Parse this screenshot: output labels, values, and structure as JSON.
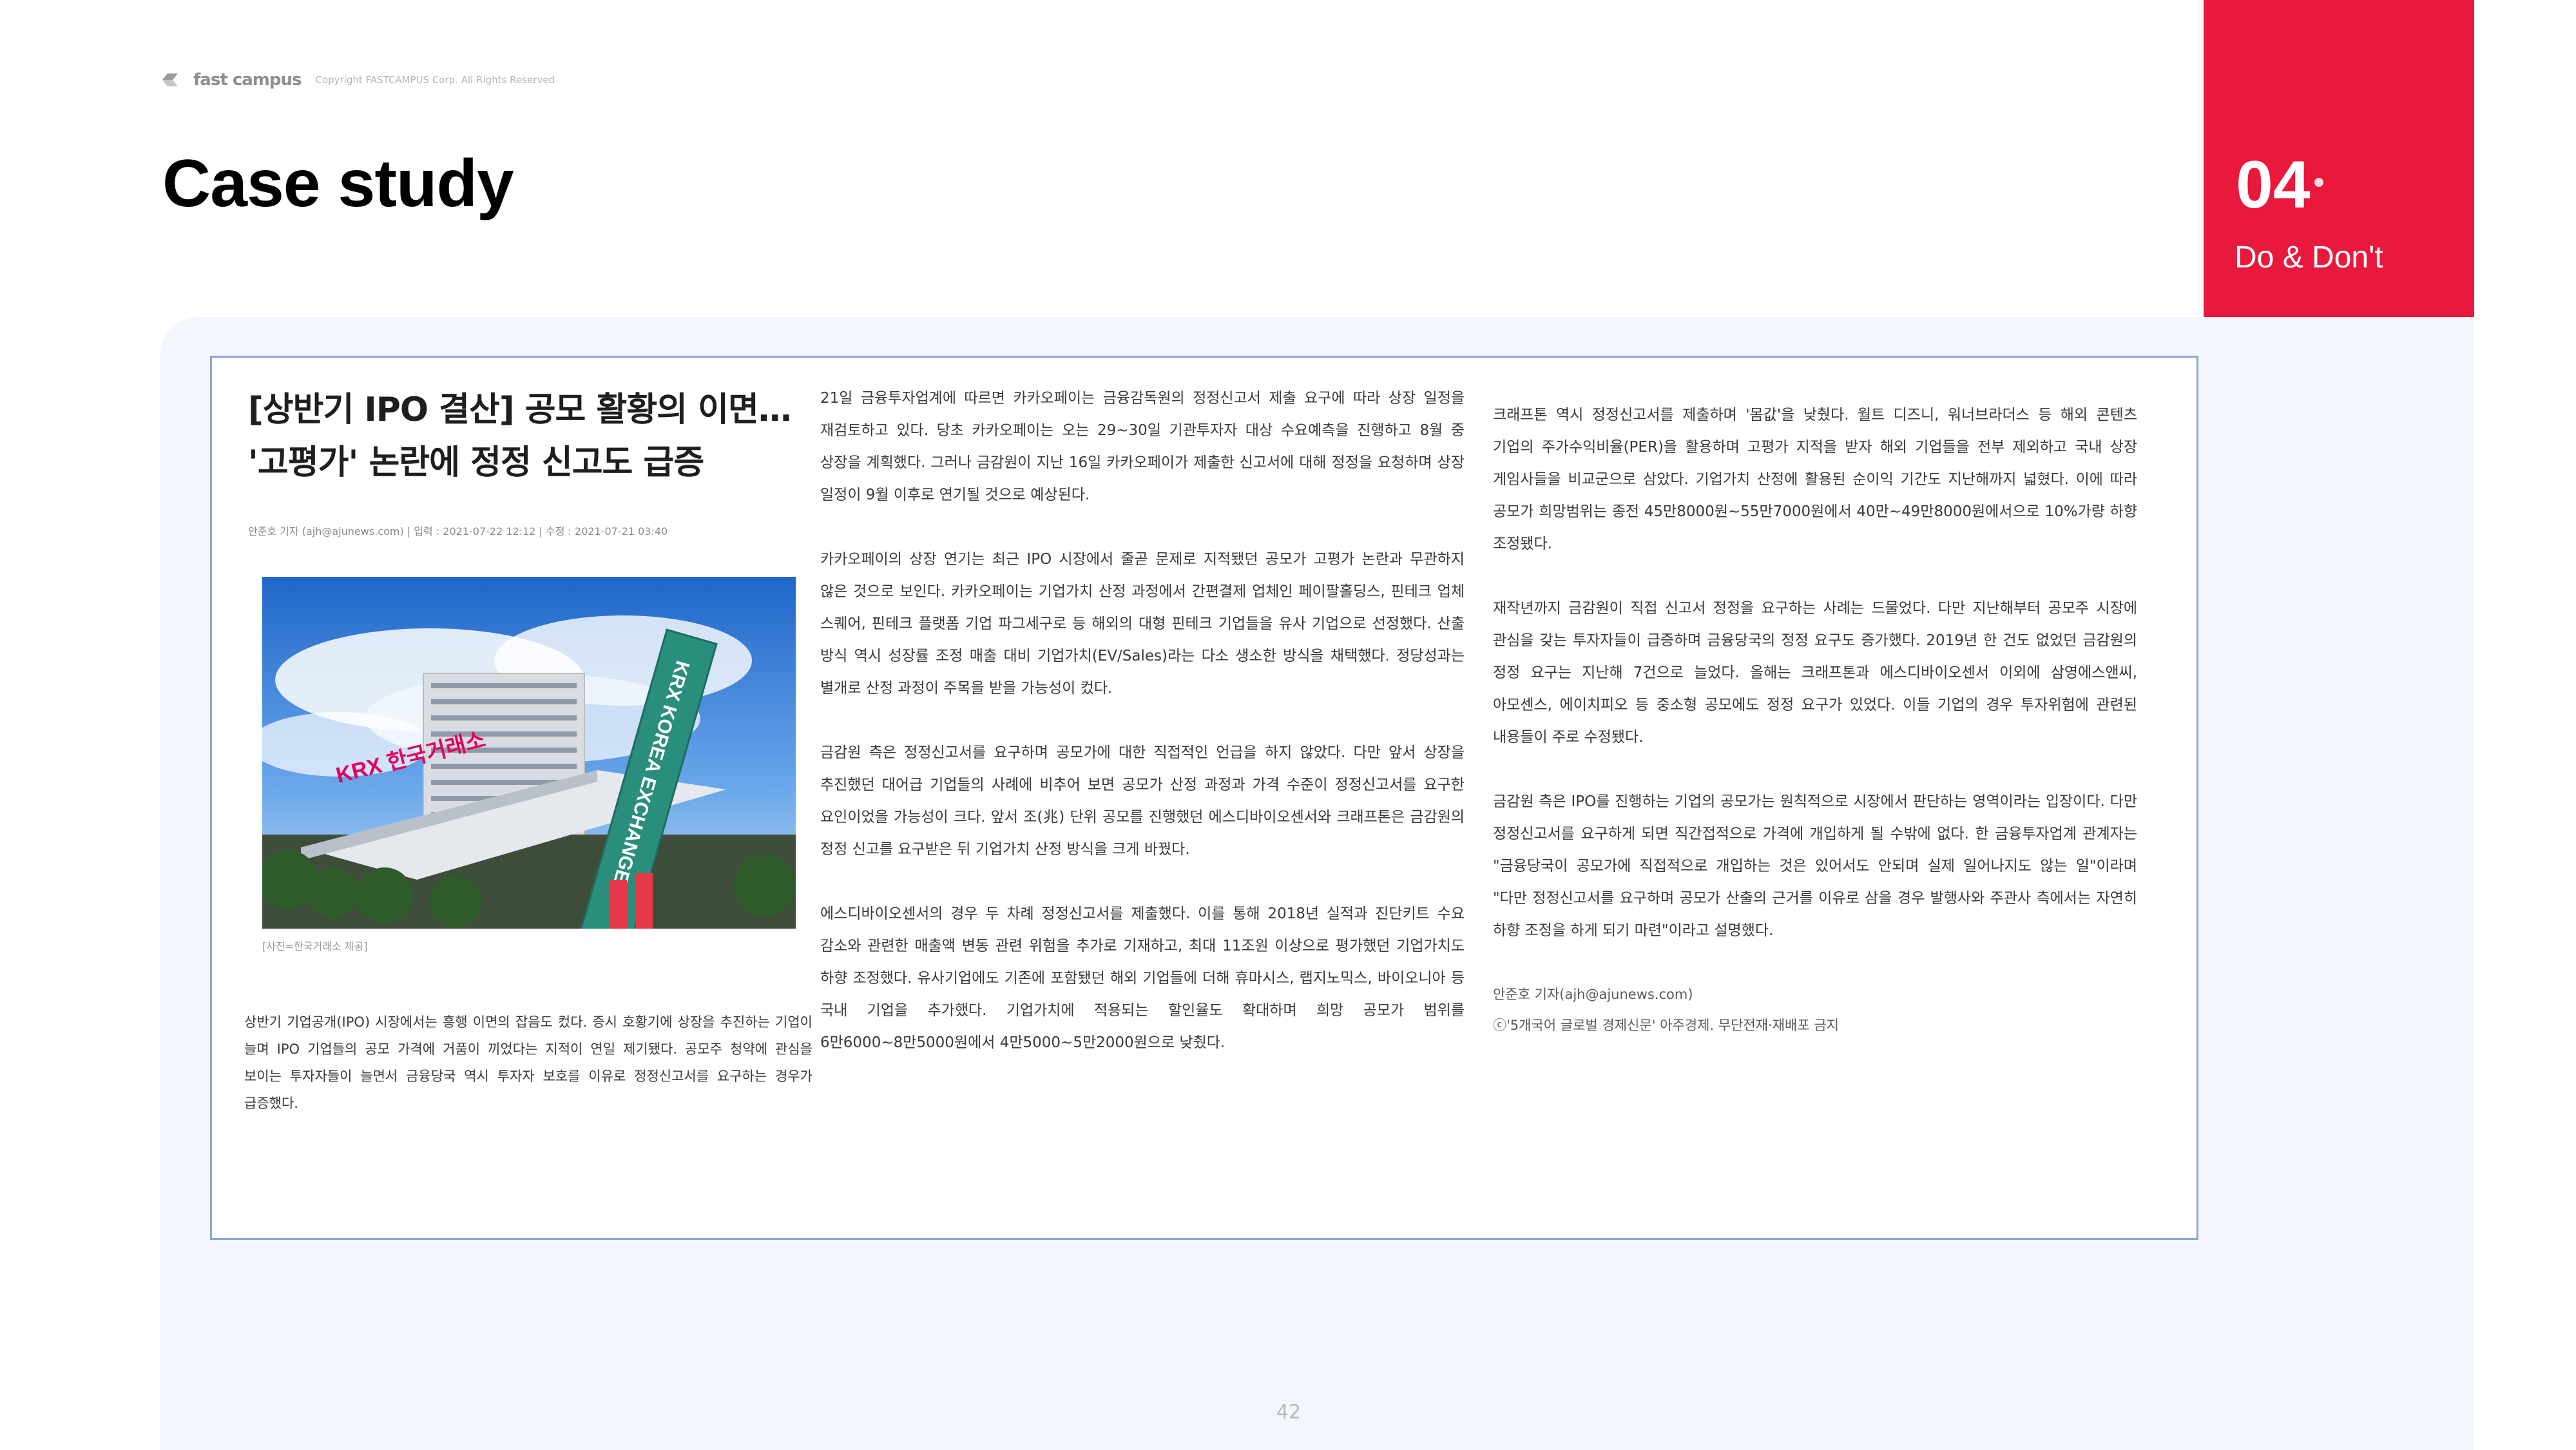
{
  "header": {
    "logo_text": "fast campus",
    "copyright": "Copyright FASTCAMPUS Corp. All Rights Reserved",
    "title": "Case study"
  },
  "section": {
    "number": "04",
    "label": "Do & Don't",
    "accent_color": "#e8193c"
  },
  "article": {
    "headline_line1": "[상반기 IPO 결산] 공모 활황의 이면…",
    "headline_line2": "'고평가' 논란에 정정 신고도 급증",
    "byline": "안준호 기자 (ajh@ajunews.com)  |  입력 : 2021-07-22 12:12  |  수정 : 2021-07-21 03:40",
    "photo_sign_text": "KRX KOREA EXCHANGE",
    "photo_building_text": "KRX 한국거래소",
    "photo_caption": "[사진=한국거래소 제공]",
    "col1_paragraphs": [
      "상반기 기업공개(IPO) 시장에서는 흥행 이면의 잡음도 컸다. 증시 호황기에 상장을 추진하는 기업이 늘며 IPO 기업들의 공모 가격에 거품이 끼었다는 지적이 연일 제기됐다. 공모주 청약에 관심을 보이는 투자자들이 늘면서 금융당국 역시 투자자 보호를 이유로 정정신고서를 요구하는 경우가 급증했다."
    ],
    "col2_paragraphs": [
      "21일 금융투자업계에 따르면 카카오페이는 금융감독원의 정정신고서 제출 요구에 따라 상장 일정을 재검토하고 있다. 당초 카카오페이는 오는 29~30일 기관투자자 대상 수요예측을 진행하고 8월 중 상장을 계획했다. 그러나 금감원이 지난 16일 카카오페이가 제출한 신고서에 대해 정정을 요청하며 상장 일정이 9월 이후로 연기될 것으로 예상된다.",
      "카카오페이의 상장 연기는 최근 IPO 시장에서 줄곧 문제로 지적됐던 공모가 고평가 논란과 무관하지 않은 것으로 보인다. 카카오페이는 기업가치 산정 과정에서 간편결제 업체인 페이팔홀딩스, 핀테크 업체 스퀘어, 핀테크 플랫폼 기업 파그세구로 등 해외의 대형 핀테크 기업들을 유사 기업으로 선정했다. 산출 방식 역시 성장률 조정 매출 대비 기업가치(EV/Sales)라는 다소 생소한 방식을 채택했다. 정당성과는 별개로 산정 과정이 주목을 받을 가능성이 컸다.",
      "금감원 측은 정정신고서를 요구하며 공모가에 대한 직접적인 언급을 하지 않았다. 다만 앞서 상장을 추진했던 대어급 기업들의 사례에 비추어 보면 공모가 산정 과정과 가격 수준이 정정신고서를 요구한 요인이었을 가능성이 크다. 앞서 조(兆) 단위 공모를 진행했던 에스디바이오센서와 크래프톤은 금감원의 정정 신고를 요구받은 뒤 기업가치 산정 방식을 크게 바꿨다.",
      "에스디바이오센서의 경우 두 차례 정정신고서를 제출했다. 이를 통해 2018년 실적과 진단키트 수요 감소와 관련한 매출액 변동 관련 위험을 추가로 기재하고, 최대 11조원 이상으로 평가했던 기업가치도 하향 조정했다. 유사기업에도 기존에 포함됐던 해외 기업들에 더해 휴마시스, 랩지노믹스, 바이오니아 등 국내 기업을 추가했다. 기업가치에 적용되는 할인율도 확대하며 희망 공모가 범위를 6만6000~8만5000원에서 4만5000~5만2000원으로 낮췄다."
    ],
    "col3_paragraphs": [
      "크래프톤 역시 정정신고서를 제출하며 '몸값'을 낮췄다. 월트 디즈니, 워너브라더스 등 해외 콘텐츠 기업의 주가수익비율(PER)을 활용하며 고평가 지적을 받자 해외 기업들을 전부 제외하고 국내 상장 게임사들을 비교군으로 삼았다. 기업가치 산정에 활용된 순이익 기간도 지난해까지 넓혔다. 이에 따라 공모가 희망범위는 종전 45만8000원~55만7000원에서 40만~49만8000원에서으로 10%가량 하향 조정됐다.",
      "재작년까지 금감원이 직접 신고서 정정을 요구하는 사례는 드물었다. 다만 지난해부터 공모주 시장에 관심을 갖는 투자자들이 급증하며 금융당국의 정정 요구도 증가했다. 2019년 한 건도 없었던 금감원의 정정 요구는 지난해 7건으로 늘었다. 올해는 크래프톤과 에스디바이오센서 이외에 삼영에스앤씨, 아모센스, 에이치피오 등 중소형 공모에도 정정 요구가 있었다. 이들 기업의 경우 투자위험에 관련된 내용들이 주로 수정됐다.",
      "금감원 측은 IPO를 진행하는 기업의 공모가는 원칙적으로 시장에서 판단하는 영역이라는 입장이다. 다만 정정신고서를 요구하게 되면 직간접적으로 가격에 개입하게 될 수밖에 없다. 한 금융투자업계 관계자는 \"금융당국이 공모가에 직접적으로 개입하는 것은 있어서도 안되며 실제 일어나지도 않는 일\"이라며 \"다만 정정신고서를 요구하며 공모가 산출의 근거를 이유로 삼을 경우 발행사와 주관사 측에서는 자연히 하향 조정을 하게 되기 마련\"이라고 설명했다."
    ],
    "reporter": "안준호 기자(ajh@ajunews.com)",
    "copyright_notice": "ⓒ'5개국어 글로벌 경제신문' 아주경제. 무단전재·재배포 금지"
  },
  "footer": {
    "page_number": "42"
  }
}
